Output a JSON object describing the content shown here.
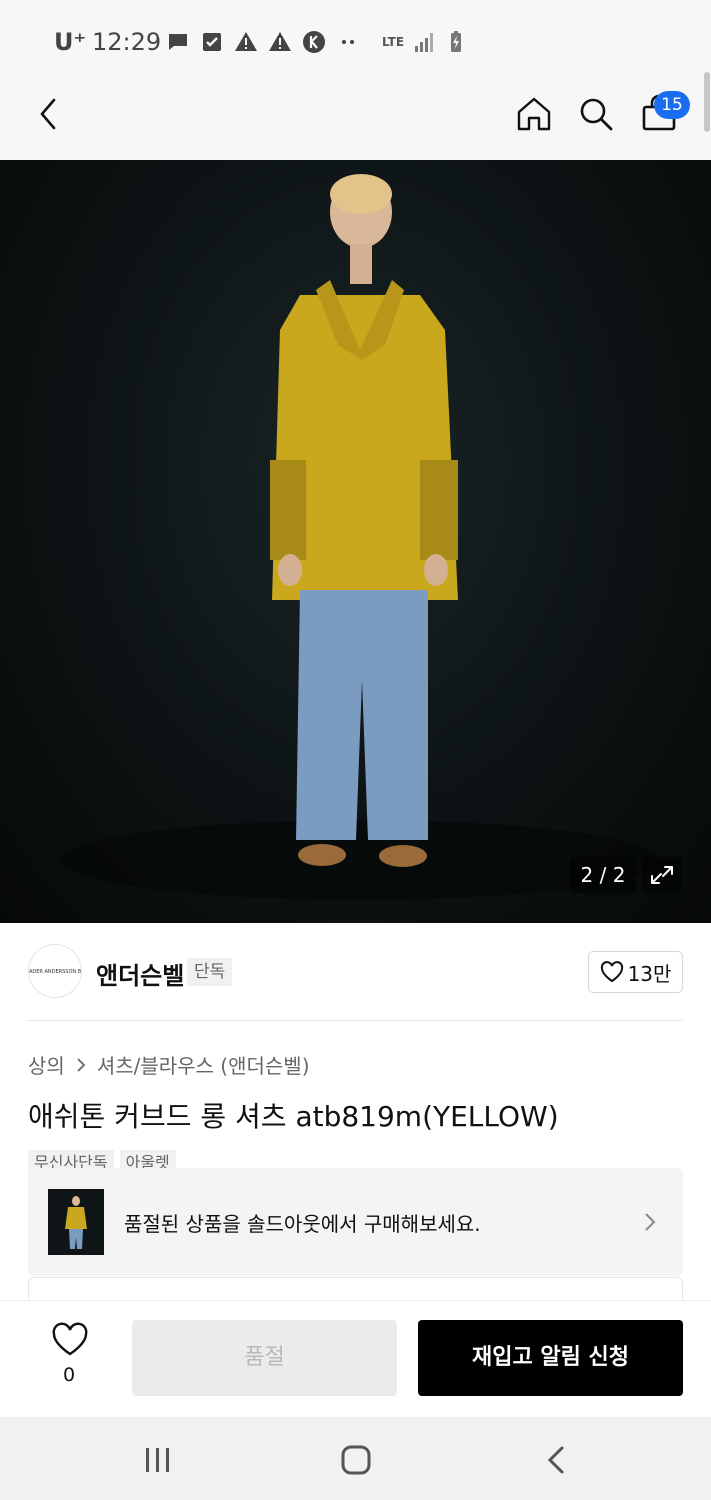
{
  "status_bar": {
    "carrier": "U⁺",
    "time": "12:29",
    "network": "LTE",
    "icons": [
      "chat-icon",
      "check-box-icon",
      "warning-icon",
      "warning-icon",
      "k-app-icon",
      "more-dots-icon",
      "signal-icon",
      "battery-charging-icon"
    ]
  },
  "header": {
    "cart_count": "15"
  },
  "gallery": {
    "counter": "2 / 2"
  },
  "brand": {
    "logo_text": "ADER ANDERSSON BELL",
    "name": "앤더슨벨",
    "tag": "단독",
    "like_count": "13만"
  },
  "product": {
    "breadcrumb": [
      "상의",
      "셔츠/블라우스 (앤더슨벨)"
    ],
    "title": "애쉬톤 커브드 롱 셔츠 atb819m(YELLOW)",
    "tags": [
      "무신사단독",
      "아울렛"
    ]
  },
  "soldout_banner": {
    "text": "품절된 상품을 솔드아웃에서 구매해보세요."
  },
  "actions": {
    "wish_count": "0",
    "soldout_label": "품절",
    "restock_label": "재입고 알림 신청"
  },
  "colors": {
    "accent_blue": "#1a6cf0",
    "primary_black": "#000000",
    "disabled_gray": "#ebebeb",
    "shirt_yellow": "#c9a81e",
    "jeans_blue": "#7b9bc0"
  }
}
